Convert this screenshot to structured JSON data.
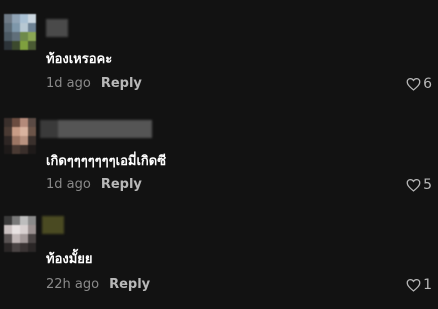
{
  "comments": [
    {
      "text": "ท้องเหรอคะ",
      "time": "1d ago",
      "reply_label": "Reply",
      "likes": "6"
    },
    {
      "text": "เกิดๆๆๆๆๆๆๆเอมี่เกิดซี",
      "time": "1d ago",
      "reply_label": "Reply",
      "likes": "5"
    },
    {
      "text": "ท้องมั้ยย",
      "time": "22h ago",
      "reply_label": "Reply",
      "likes": "1"
    }
  ],
  "icons": {
    "like": "heart-outline-icon",
    "avatar": "blurred-avatar"
  },
  "colors": {
    "background": "#121212",
    "meta": "#8a8a8a",
    "reply": "#b8b8b8"
  }
}
